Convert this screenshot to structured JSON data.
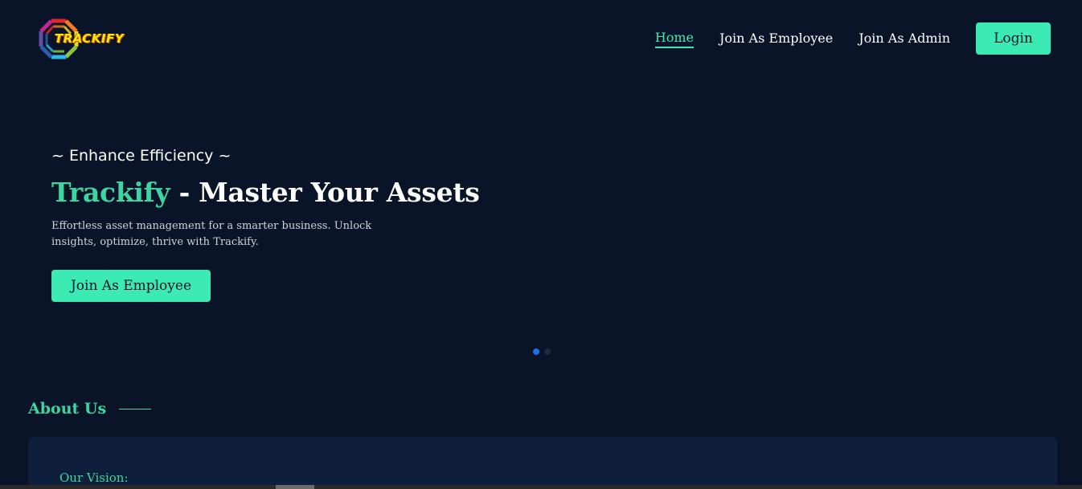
{
  "brand": {
    "logo_text": "TRACKIFY"
  },
  "nav": {
    "items": [
      {
        "label": "Home",
        "active": true
      },
      {
        "label": "Join As Employee",
        "active": false
      },
      {
        "label": "Join As Admin",
        "active": false
      }
    ],
    "login_label": "Login"
  },
  "hero": {
    "tagline": "~ Enhance Efficiency ~",
    "title_brand": "Trackify",
    "title_rest": " - Master Your Assets",
    "description": "Effortless asset management for a smarter business. Unlock insights, optimize, thrive with Trackify.",
    "cta_label": "Join As Employee",
    "slides_total": 2,
    "slide_active": 1
  },
  "about": {
    "heading": "About Us",
    "vision_label": "Our Vision:"
  },
  "colors": {
    "background": "#0a1428",
    "accent": "#3cebb4",
    "accent_text": "#3cd6a0",
    "card": "#0f1f3b",
    "dot_active": "#1a73e8"
  }
}
